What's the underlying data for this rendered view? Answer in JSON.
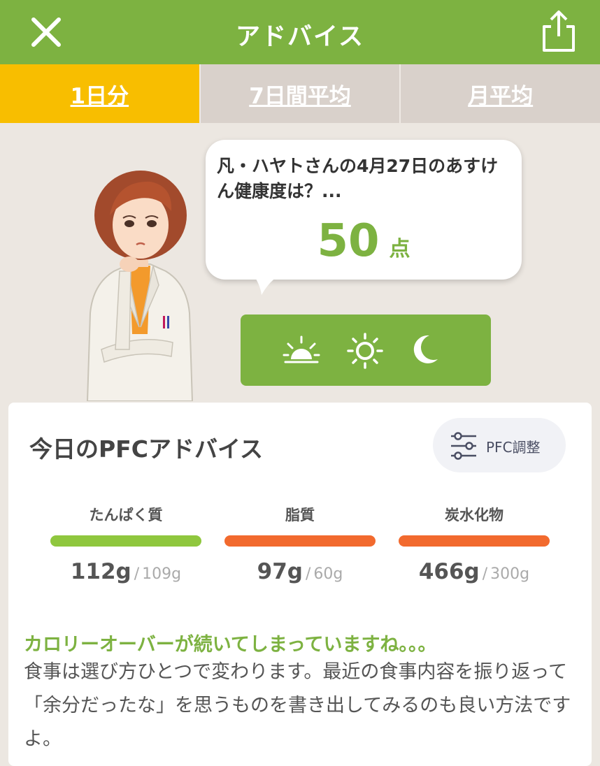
{
  "header": {
    "title": "アドバイス",
    "close_icon": "close-icon",
    "share_icon": "share-icon"
  },
  "tabs": [
    {
      "label": "1日分",
      "active": true
    },
    {
      "label": "7日間平均",
      "active": false
    },
    {
      "label": "月平均",
      "active": false
    }
  ],
  "bubble": {
    "message": "凡・ハヤトさんの4月27日のあすけん健康度は？...",
    "score": "50",
    "score_unit": "点"
  },
  "time_of_day": [
    {
      "icon": "sunrise-icon"
    },
    {
      "icon": "sun-icon"
    },
    {
      "icon": "moon-icon"
    }
  ],
  "pfc": {
    "title": "今日のPFCアドバイス",
    "adjust_label": "PFC調整",
    "nutrients": [
      {
        "label": "たんぱく質",
        "current": "112g",
        "goal": "109g",
        "color": "#8fc73e"
      },
      {
        "label": "脂質",
        "current": "97g",
        "goal": "60g",
        "color": "#f26a2e"
      },
      {
        "label": "炭水化物",
        "current": "466g",
        "goal": "300g",
        "color": "#f26a2e"
      }
    ]
  },
  "advice": {
    "headline": "カロリーオーバーが続いてしまっていますね。。。",
    "body": "食事は選び方ひとつで変わります。最近の食事内容を振り返って「余分だったな」を思うものを書き出してみるのも良い方法ですよ。"
  },
  "colors": {
    "brand_green": "#7db241",
    "tab_active": "#f8be00",
    "tab_inactive": "#d9d1cb",
    "background": "#ece7e1"
  }
}
